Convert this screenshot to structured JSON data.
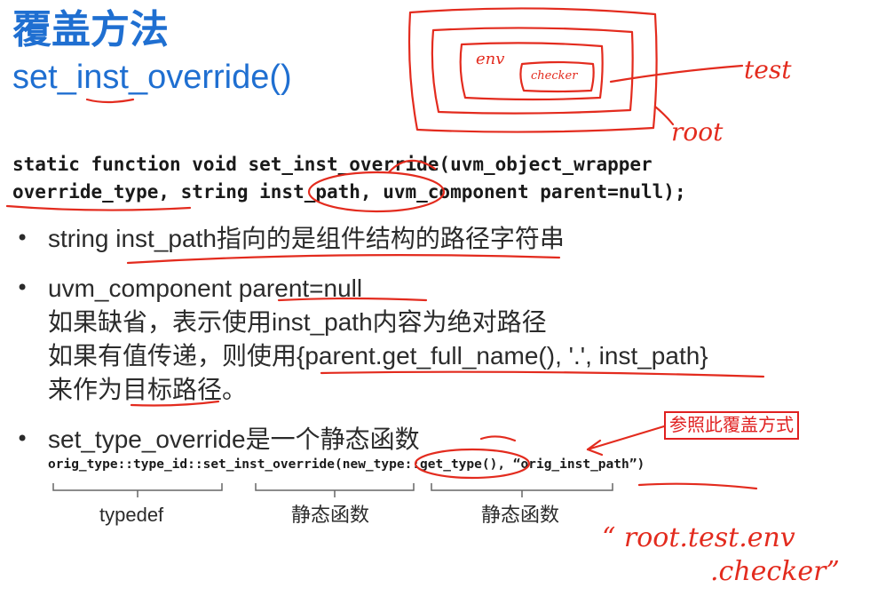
{
  "title": "覆盖方法",
  "subtitle": "set_inst_override()",
  "signature": {
    "line1": "static function void set_inst_override(uvm_object_wrapper",
    "line2": "override_type, string inst_path, uvm_component parent=null);"
  },
  "bullets": {
    "mark": "•",
    "b1": "string inst_path指向的是组件结构的路径字符串",
    "b2": {
      "l1": "uvm_component parent=null",
      "l2": "如果缺省，表示使用inst_path内容为绝对路径",
      "l3": "如果有值传递，则使用{parent.get_full_name(), '.', inst_path}",
      "l4": "来作为目标路径。"
    },
    "b3": "set_type_override是一个静态函数"
  },
  "example_code": "orig_type::type_id::set_inst_override(new_type::get_type(), “orig_inst_path”)",
  "captions": [
    "typedef",
    "静态函数",
    "静态函数"
  ],
  "note": "参照此覆盖方式",
  "handwriting": {
    "env": "env",
    "checker": "checker",
    "test": "test",
    "root": "root",
    "path_line1": "“ root.test.env",
    "path_line2": ".checker”"
  },
  "colors": {
    "title": "#1f6fd1",
    "ink": "#e32b1e",
    "text": "#2b2b2b"
  }
}
